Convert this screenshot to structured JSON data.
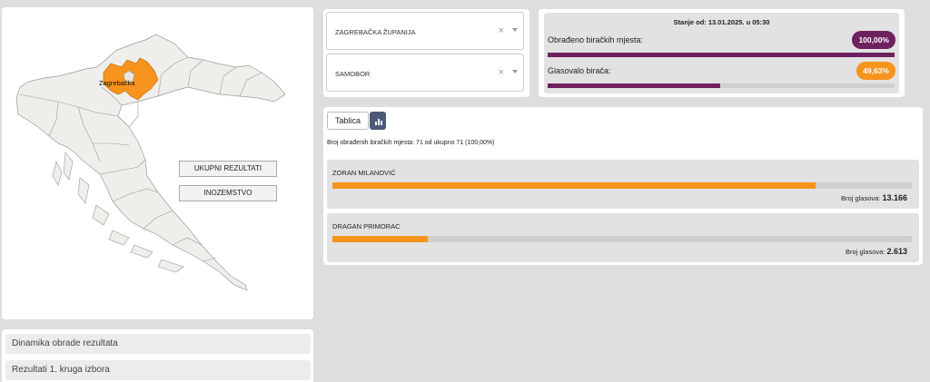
{
  "map": {
    "highlight_label": "Zagrebačka",
    "buttons": {
      "total": "UKUPNI REZULTATI",
      "abroad": "INOZEMSTVO"
    },
    "highlight_color": "#f7941d",
    "base_color": "#efeeea"
  },
  "accordion": {
    "items": [
      "Dinamika obrade rezultata",
      "Rezultati 1. kruga izbora"
    ]
  },
  "filters": {
    "county": "ZAGREBAČKA ŽUPANIJA",
    "city": "SAMOBOR",
    "clear_symbol": "×"
  },
  "status": {
    "title": "Stanje od: 13.01.2025. u 05:30",
    "processed_label": "Obrađeno biračkih mjesta:",
    "processed_value": "100,00%",
    "processed_fraction": 1.0,
    "turnout_label": "Glasovalo birača:",
    "turnout_value": "49,63%",
    "turnout_fraction": 0.4963,
    "colors": {
      "processed": "#6e2160",
      "turnout": "#f7941d"
    }
  },
  "results": {
    "tab_label": "Tablica",
    "summary": "Broj obrađenih biračkih mjesta: 71 od ukupno 71 (100,00%)",
    "votes_label": "Broj glasova:",
    "candidates": [
      {
        "name": "ZORAN MILANOVIĆ",
        "votes": "13.166",
        "fraction": 0.834
      },
      {
        "name": "DRAGAN PRIMORAC",
        "votes": "2.613",
        "fraction": 0.165
      }
    ]
  }
}
